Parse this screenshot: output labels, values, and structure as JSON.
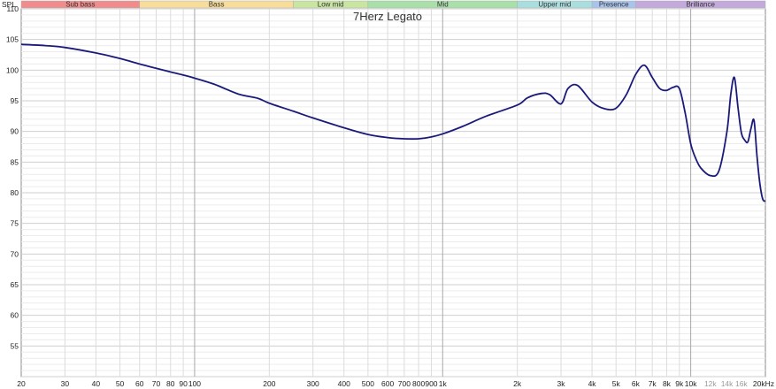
{
  "chart_data": {
    "type": "line",
    "title": "7Herz Legato",
    "ylabel": "SPL",
    "xunit": "Hz",
    "xscale": "log",
    "xlim": [
      20,
      20000
    ],
    "ylim": [
      50,
      110
    ],
    "grid": true,
    "bands": [
      {
        "name": "Sub bass",
        "from": 20,
        "to": 60,
        "color": "#f08c8c"
      },
      {
        "name": "Bass",
        "from": 60,
        "to": 250,
        "color": "#f8dc9a"
      },
      {
        "name": "Low mid",
        "from": 250,
        "to": 500,
        "color": "#c8e6a0"
      },
      {
        "name": "Mid",
        "from": 500,
        "to": 2000,
        "color": "#a9e0a9"
      },
      {
        "name": "Upper mid",
        "from": 2000,
        "to": 4000,
        "color": "#a9dede"
      },
      {
        "name": "Presence",
        "from": 4000,
        "to": 6000,
        "color": "#a9c4ec"
      },
      {
        "name": "Brilliance",
        "from": 6000,
        "to": 20000,
        "color": "#c4a9dc"
      }
    ],
    "x_ticks": [
      {
        "v": 20,
        "label": "20"
      },
      {
        "v": 30,
        "label": "30"
      },
      {
        "v": 40,
        "label": "40"
      },
      {
        "v": 50,
        "label": "50"
      },
      {
        "v": 60,
        "label": "60"
      },
      {
        "v": 70,
        "label": "70"
      },
      {
        "v": 80,
        "label": "80"
      },
      {
        "v": 90,
        "label": "90"
      },
      {
        "v": 100,
        "label": "100"
      },
      {
        "v": 200,
        "label": "200"
      },
      {
        "v": 300,
        "label": "300"
      },
      {
        "v": 400,
        "label": "400"
      },
      {
        "v": 500,
        "label": "500"
      },
      {
        "v": 600,
        "label": "600"
      },
      {
        "v": 700,
        "label": "700"
      },
      {
        "v": 800,
        "label": "800"
      },
      {
        "v": 900,
        "label": "900"
      },
      {
        "v": 1000,
        "label": "1k"
      },
      {
        "v": 2000,
        "label": "2k"
      },
      {
        "v": 3000,
        "label": "3k"
      },
      {
        "v": 4000,
        "label": "4k"
      },
      {
        "v": 5000,
        "label": "5k"
      },
      {
        "v": 6000,
        "label": "6k"
      },
      {
        "v": 7000,
        "label": "7k"
      },
      {
        "v": 8000,
        "label": "8k"
      },
      {
        "v": 9000,
        "label": "9k"
      },
      {
        "v": 10000,
        "label": "10k"
      },
      {
        "v": 12000,
        "label": "12k",
        "muted": true
      },
      {
        "v": 14000,
        "label": "14k",
        "muted": true
      },
      {
        "v": 16000,
        "label": "16k",
        "muted": true
      },
      {
        "v": 20000,
        "label": "20kHz"
      }
    ],
    "y_ticks": [
      55,
      60,
      65,
      70,
      75,
      80,
      85,
      90,
      95,
      100,
      105,
      110
    ],
    "series": [
      {
        "color": "#1a1a7a",
        "x": [
          20,
          25,
          30,
          40,
          50,
          60,
          70,
          80,
          90,
          100,
          120,
          150,
          180,
          200,
          250,
          300,
          400,
          500,
          600,
          700,
          800,
          900,
          1000,
          1200,
          1500,
          2000,
          2200,
          2500,
          2700,
          3000,
          3200,
          3500,
          4000,
          4500,
          5000,
          5500,
          6000,
          6500,
          7000,
          7500,
          8000,
          8500,
          9000,
          9500,
          10000,
          10500,
          11000,
          12000,
          13000,
          14000,
          14500,
          15000,
          15500,
          16000,
          16500,
          17000,
          17500,
          18000,
          18500,
          19000,
          19500,
          20000
        ],
        "y": [
          104.2,
          104.0,
          103.7,
          102.8,
          101.9,
          101.0,
          100.3,
          99.7,
          99.2,
          98.7,
          97.7,
          96.1,
          95.4,
          94.6,
          93.3,
          92.2,
          90.6,
          89.5,
          89.0,
          88.8,
          88.8,
          89.1,
          89.6,
          90.8,
          92.5,
          94.3,
          95.5,
          96.2,
          96.0,
          94.5,
          97.0,
          97.5,
          94.8,
          93.7,
          93.8,
          96.0,
          99.3,
          100.8,
          98.8,
          97.0,
          96.7,
          97.2,
          97.0,
          93.0,
          88.0,
          85.5,
          84.0,
          82.8,
          83.6,
          90.0,
          96.0,
          98.8,
          94.0,
          89.8,
          88.6,
          88.3,
          90.5,
          91.8,
          86.0,
          81.5,
          79.0,
          78.6
        ]
      }
    ]
  }
}
